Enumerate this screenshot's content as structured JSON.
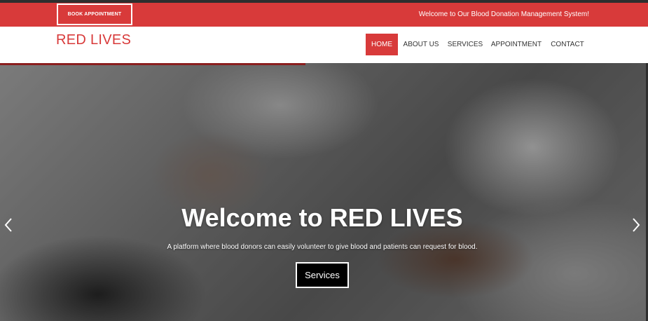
{
  "topbar": {
    "book_button": "BOOK APPOINTMENT",
    "welcome": "Welcome to Our Blood Donation Management System!"
  },
  "brand": "RED LIVES",
  "nav": {
    "items": [
      {
        "label": "HOME",
        "active": true
      },
      {
        "label": "ABOUT US"
      },
      {
        "label": "SERVICES"
      },
      {
        "label": "APPOINTMENT"
      },
      {
        "label": "CONTACT"
      }
    ]
  },
  "hero": {
    "title": "Welcome to RED LIVES",
    "subtitle": "A platform where blood donors can easily volunteer to give blood and patients can request for blood.",
    "button": "Services",
    "prev_icon": "chevron-left-icon",
    "next_icon": "chevron-right-icon"
  },
  "colors": {
    "accent": "#d83a3a",
    "dark_line": "#8b1e1e"
  }
}
